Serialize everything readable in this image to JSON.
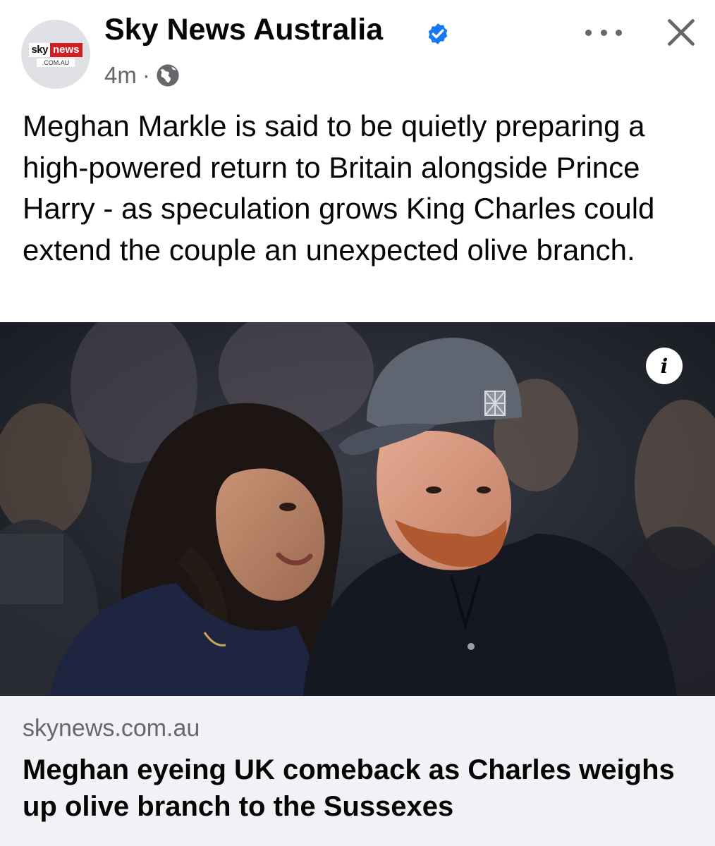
{
  "post": {
    "page_name": "Sky News Australia",
    "verified": true,
    "time_ago": "4m",
    "separator": "·",
    "audience_icon": "globe-icon",
    "caption": "Meghan Markle is said to be quietly preparing a high-powered return to Britain alongside Prince Harry - as speculation grows King Charles could extend the couple an unexpected olive branch."
  },
  "avatar_logo": {
    "brand_part1": "sky",
    "brand_part2": "news",
    "domain": ".COM.AU"
  },
  "actions": {
    "more_icon": "more-horizontal-icon",
    "close_icon": "close-icon"
  },
  "photo": {
    "info_icon": "info-icon",
    "info_glyph": "i"
  },
  "link": {
    "domain": "skynews.com.au",
    "title": "Meghan eyeing UK comeback as Charles weighs up olive branch to the Sussexes"
  },
  "colors": {
    "verified_blue": "#1877f2",
    "secondary_text": "#65676b",
    "card_background": "#f0f2f5",
    "brand_red": "#d21f26"
  }
}
